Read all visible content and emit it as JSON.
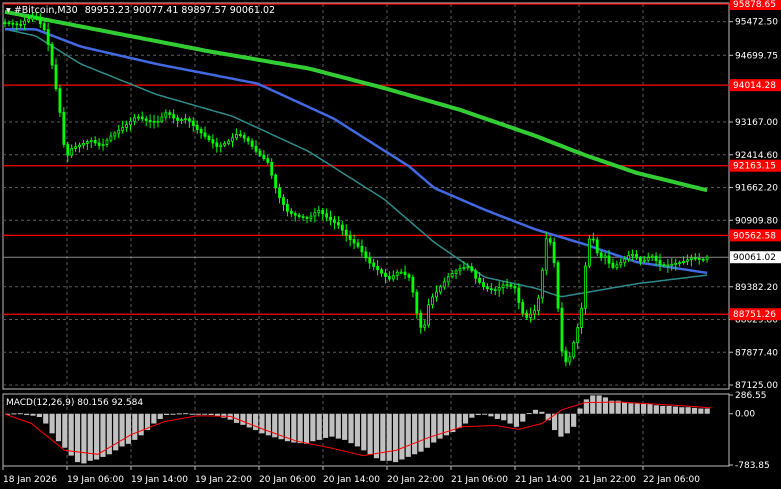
{
  "header": {
    "symbol": "#Bitcoin,M30",
    "ohlc": "89953.23 90077.41 89897.57 90061.02"
  },
  "colors": {
    "background": "#000000",
    "grid": "#5a5a5a",
    "candle": "#00ff00",
    "ma_slow": "#32cd32",
    "ma_mid": "#4169e1",
    "ma_fast": "#2e8b8b",
    "level": "#ff0000",
    "macd_hist": "#c0c0c0",
    "macd_signal": "#ff0000",
    "current_price_box": "#ffffff"
  },
  "chart_data": [
    {
      "type": "candlestick",
      "ylim": [
        87125,
        95878.65
      ],
      "y_ticks": [
        "95472.50",
        "94699.75",
        "93167.00",
        "92414.60",
        "91662.20",
        "90909.80",
        "89382.20",
        "88629.80",
        "87877.40",
        "87125.00"
      ],
      "x_ticks": [
        "18 Jan 2026",
        "19 Jan 06:00",
        "19 Jan 14:00",
        "19 Jan 22:00",
        "20 Jan 06:00",
        "20 Jan 14:00",
        "20 Jan 22:00",
        "21 Jan 06:00",
        "21 Jan 14:00",
        "21 Jan 22:00",
        "22 Jan 06:00"
      ],
      "current_price": "90061.02",
      "levels": [
        {
          "label": "95878.65",
          "value": 95878.65
        },
        {
          "label": "94014.28",
          "value": 94014.28
        },
        {
          "label": "92163.15",
          "value": 92163.15
        },
        {
          "label": "90562.58",
          "value": 90562.58
        },
        {
          "label": "88751.26",
          "value": 88751.26
        }
      ],
      "close_path": [
        [
          0,
          95450
        ],
        [
          3,
          95400
        ],
        [
          4,
          95500
        ],
        [
          6,
          95600
        ],
        [
          8,
          95250
        ],
        [
          9,
          94700
        ],
        [
          10,
          94000
        ],
        [
          11,
          93300
        ],
        [
          12,
          92300
        ],
        [
          13,
          92550
        ],
        [
          15,
          92650
        ],
        [
          17,
          92750
        ],
        [
          19,
          92600
        ],
        [
          21,
          92850
        ],
        [
          24,
          93100
        ],
        [
          26,
          93300
        ],
        [
          28,
          93200
        ],
        [
          30,
          93150
        ],
        [
          32,
          93400
        ],
        [
          34,
          93200
        ],
        [
          36,
          93250
        ],
        [
          38,
          93000
        ],
        [
          40,
          92800
        ],
        [
          42,
          92600
        ],
        [
          44,
          92700
        ],
        [
          46,
          92900
        ],
        [
          48,
          92750
        ],
        [
          50,
          92450
        ],
        [
          52,
          92250
        ],
        [
          54,
          91500
        ],
        [
          56,
          91100
        ],
        [
          58,
          91000
        ],
        [
          60,
          90950
        ],
        [
          62,
          91150
        ],
        [
          64,
          90950
        ],
        [
          66,
          90800
        ],
        [
          68,
          90500
        ],
        [
          70,
          90300
        ],
        [
          72,
          89950
        ],
        [
          74,
          89750
        ],
        [
          76,
          89550
        ],
        [
          78,
          89750
        ],
        [
          80,
          89600
        ],
        [
          81,
          89150
        ],
        [
          82,
          88450
        ],
        [
          83,
          88450
        ],
        [
          84,
          89050
        ],
        [
          86,
          89350
        ],
        [
          88,
          89650
        ],
        [
          90,
          89800
        ],
        [
          92,
          89850
        ],
        [
          93,
          89600
        ],
        [
          95,
          89350
        ],
        [
          97,
          89300
        ],
        [
          99,
          89450
        ],
        [
          101,
          89350
        ],
        [
          102,
          88900
        ],
        [
          103,
          88650
        ],
        [
          105,
          88850
        ],
        [
          106,
          89300
        ],
        [
          107,
          90500
        ],
        [
          108,
          90400
        ],
        [
          109,
          89750
        ],
        [
          110,
          88000
        ],
        [
          111,
          87650
        ],
        [
          112,
          87800
        ],
        [
          113,
          88300
        ],
        [
          114,
          88700
        ],
        [
          115,
          89950
        ],
        [
          116,
          90700
        ],
        [
          117,
          90200
        ],
        [
          118,
          90050
        ],
        [
          119,
          90100
        ],
        [
          120,
          89800
        ],
        [
          122,
          89950
        ],
        [
          124,
          90150
        ],
        [
          126,
          89950
        ],
        [
          128,
          90100
        ],
        [
          130,
          89850
        ],
        [
          132,
          89900
        ],
        [
          134,
          89950
        ],
        [
          136,
          90050
        ],
        [
          138,
          90000
        ],
        [
          139,
          90061
        ]
      ],
      "ma_slow_path": [
        [
          0,
          95700
        ],
        [
          20,
          95250
        ],
        [
          40,
          94800
        ],
        [
          60,
          94400
        ],
        [
          75,
          93950
        ],
        [
          90,
          93450
        ],
        [
          105,
          92850
        ],
        [
          115,
          92400
        ],
        [
          125,
          92000
        ],
        [
          139,
          91600
        ]
      ],
      "ma_mid_path": [
        [
          0,
          95300
        ],
        [
          6,
          95300
        ],
        [
          15,
          94900
        ],
        [
          30,
          94500
        ],
        [
          50,
          94050
        ],
        [
          65,
          93250
        ],
        [
          80,
          92150
        ],
        [
          85,
          91650
        ],
        [
          95,
          91150
        ],
        [
          105,
          90700
        ],
        [
          115,
          90350
        ],
        [
          125,
          89950
        ],
        [
          139,
          89700
        ]
      ],
      "ma_fast_path": [
        [
          0,
          95300
        ],
        [
          6,
          95150
        ],
        [
          15,
          94500
        ],
        [
          30,
          93800
        ],
        [
          45,
          93300
        ],
        [
          60,
          92500
        ],
        [
          75,
          91400
        ],
        [
          85,
          90400
        ],
        [
          95,
          89600
        ],
        [
          105,
          89350
        ],
        [
          110,
          89150
        ],
        [
          115,
          89250
        ],
        [
          125,
          89450
        ],
        [
          139,
          89650
        ]
      ]
    },
    {
      "type": "macd",
      "title": "MACD(12,26,9) 80.156 92.584",
      "ylim": [
        -783.85,
        286.55
      ],
      "y_ticks": [
        "286.55",
        "0.00",
        "-783.85"
      ],
      "hist": [
        -5,
        5,
        8,
        -20,
        -30,
        -50,
        -150,
        -300,
        -420,
        -520,
        -640,
        -740,
        -760,
        -720,
        -700,
        -660,
        -620,
        -560,
        -500,
        -460,
        -400,
        -330,
        -250,
        -150,
        -80,
        -20,
        -10,
        5,
        8,
        -5,
        -10,
        -5,
        -20,
        -35,
        -60,
        -90,
        -140,
        -170,
        -210,
        -250,
        -300,
        -330,
        -360,
        -390,
        -420,
        -440,
        -450,
        -460,
        -420,
        -400,
        -370,
        -350,
        -380,
        -400,
        -450,
        -500,
        -560,
        -620,
        -680,
        -720,
        -720,
        -740,
        -700,
        -660,
        -620,
        -580,
        -520,
        -440,
        -380,
        -330,
        -280,
        -220,
        -150,
        -60,
        -20,
        0,
        -40,
        -80,
        -100,
        -150,
        -200,
        -120,
        10,
        60,
        30,
        -100,
        -250,
        -350,
        -300,
        -200,
        80,
        220,
        280,
        280,
        250,
        200,
        200,
        180,
        160,
        160,
        150,
        150,
        130,
        120,
        120,
        110,
        100,
        100,
        90,
        80,
        80
      ],
      "signal_path": [
        [
          0,
          -5
        ],
        [
          8,
          -150
        ],
        [
          18,
          -560
        ],
        [
          28,
          -620
        ],
        [
          38,
          -320
        ],
        [
          48,
          -120
        ],
        [
          58,
          -30
        ],
        [
          68,
          -40
        ],
        [
          78,
          -240
        ],
        [
          88,
          -420
        ],
        [
          98,
          -520
        ],
        [
          108,
          -640
        ],
        [
          118,
          -560
        ],
        [
          128,
          -360
        ],
        [
          138,
          -200
        ],
        [
          148,
          -180
        ],
        [
          155,
          -240
        ],
        [
          162,
          -150
        ],
        [
          168,
          60
        ],
        [
          175,
          170
        ],
        [
          185,
          180
        ],
        [
          195,
          150
        ],
        [
          205,
          120
        ],
        [
          213,
          90
        ]
      ]
    }
  ]
}
